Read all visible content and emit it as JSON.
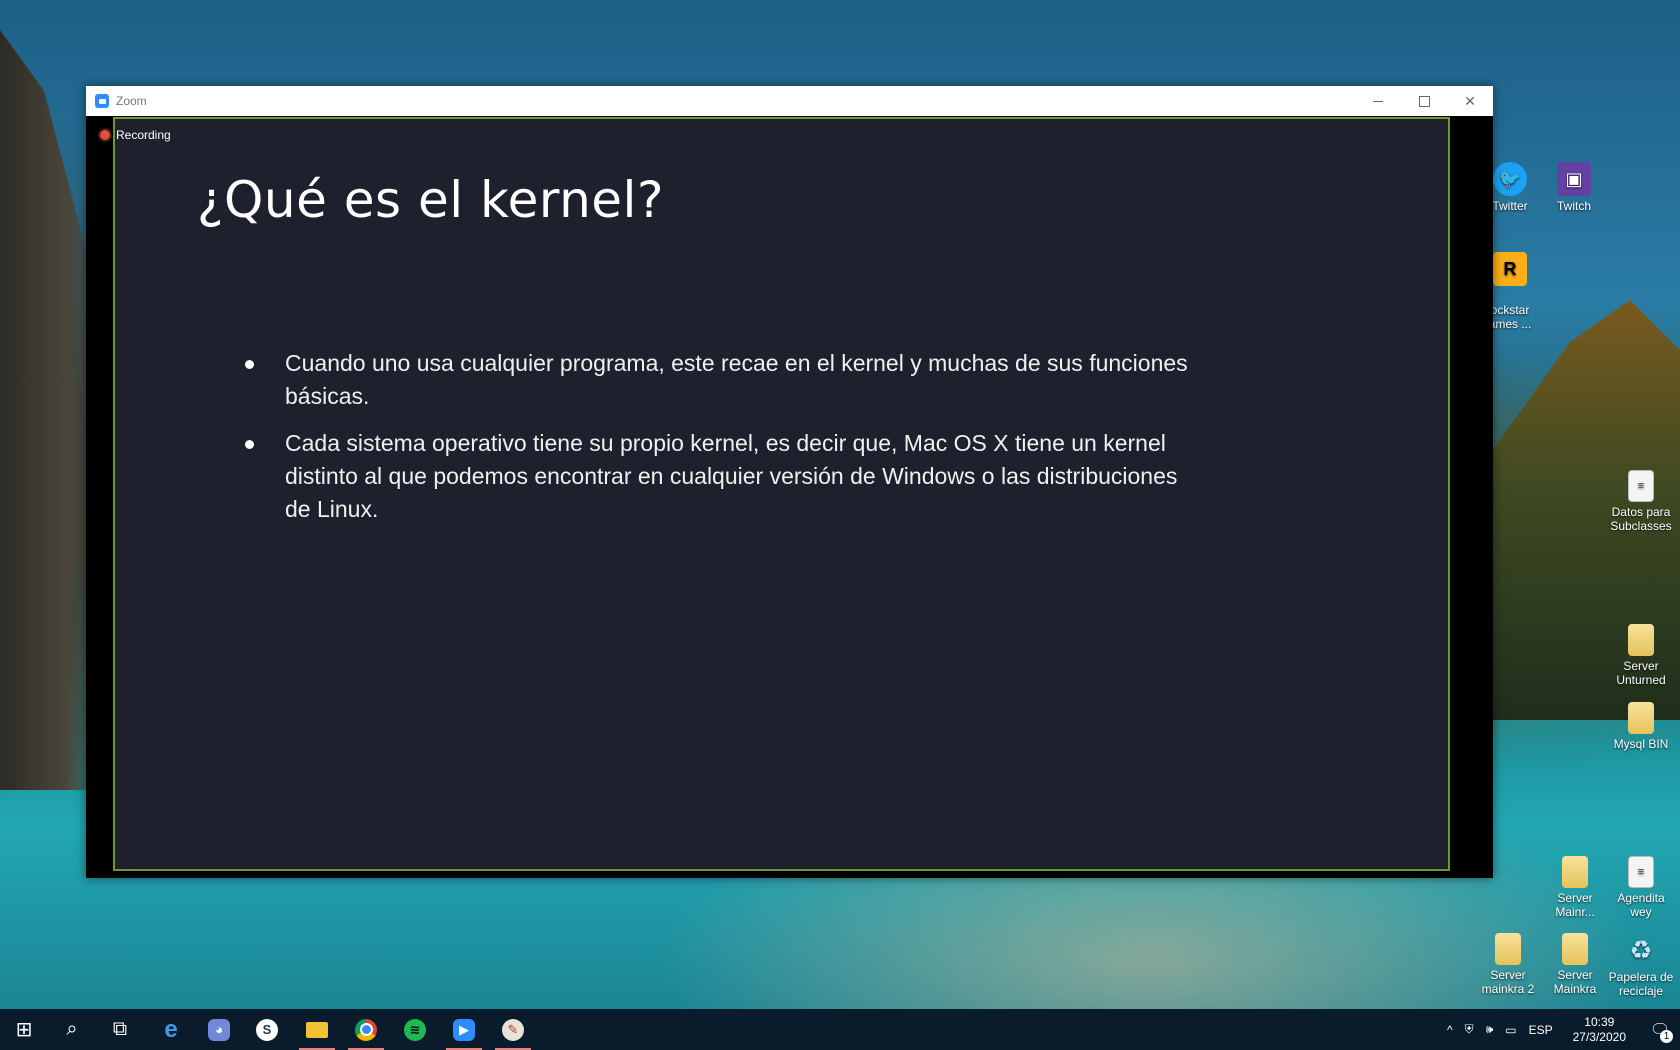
{
  "desktop_icons": [
    {
      "label": "Twitter",
      "icon": "twitter-icon",
      "glyph": "🐦"
    },
    {
      "label": "Twitch",
      "icon": "twitch-icon",
      "glyph": "▣"
    },
    {
      "label": "ockstar\names ...",
      "icon": "rockstar-icon",
      "glyph": "R"
    },
    {
      "label": "Datos para\nSubclasses",
      "icon": "document-icon",
      "glyph": "≡"
    },
    {
      "label": "Server\nUnturned",
      "icon": "folder-icon",
      "glyph": ""
    },
    {
      "label": "Mysql BIN",
      "icon": "folder-icon",
      "glyph": ""
    },
    {
      "label": "Server\nMainr...",
      "icon": "folder-icon",
      "glyph": ""
    },
    {
      "label": "Agendita\nwey",
      "icon": "document-icon",
      "glyph": "≡"
    },
    {
      "label": "Server\nmainkra 2",
      "icon": "folder-icon",
      "glyph": ""
    },
    {
      "label": "Server\nMainkra",
      "icon": "folder-icon",
      "glyph": ""
    },
    {
      "label": "Papelera de\nreciclaje",
      "icon": "recycle-bin-icon",
      "glyph": "♻"
    }
  ],
  "zoom_window": {
    "title": "Zoom",
    "recording_label": "Recording",
    "controls": {
      "minimize": "minimize",
      "maximize": "maximize",
      "close": "✕"
    }
  },
  "slide": {
    "title": "¿Qué es el kernel?",
    "bullets": [
      "Cuando uno usa cualquier programa, este recae en el kernel y muchas de sus funciones básicas.",
      "Cada sistema operativo tiene su propio kernel, es decir que, Mac OS X tiene un kernel distinto al que podemos encontrar en cualquier versión de Windows o las distribuciones de Linux."
    ]
  },
  "taskbar": {
    "start_glyph": "⊞",
    "search_glyph": "⌕",
    "taskview_glyph": "⧉",
    "apps": [
      {
        "name": "edge",
        "glyph": "e"
      },
      {
        "name": "discord",
        "glyph": "◕"
      },
      {
        "name": "steam",
        "glyph": "S"
      },
      {
        "name": "file-explorer",
        "glyph": ""
      },
      {
        "name": "chrome",
        "glyph": ""
      },
      {
        "name": "spotify",
        "glyph": "≋"
      },
      {
        "name": "zoom",
        "glyph": "▶"
      },
      {
        "name": "paint",
        "glyph": "✎"
      }
    ],
    "tray": {
      "chevron": "^",
      "language": "ESP",
      "time": "10:39",
      "date": "27/3/2020",
      "notification_count": "1"
    }
  }
}
